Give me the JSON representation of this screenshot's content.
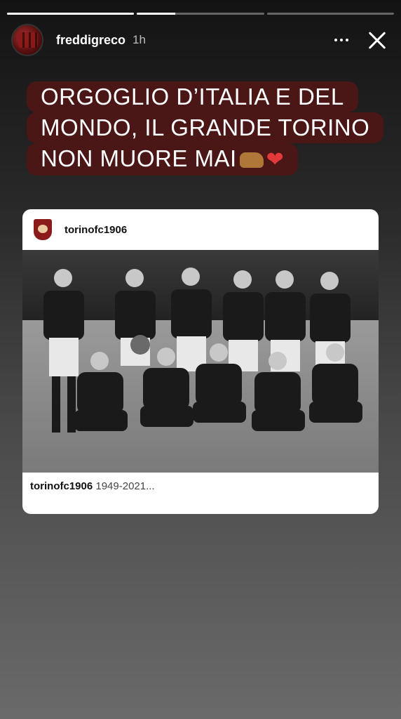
{
  "story": {
    "progress_segments": [
      1,
      0.3,
      0
    ],
    "username": "freddigreco",
    "time": "1h",
    "caption_lines": [
      "ORGOGLIO D’ITALIA E DEL",
      "MONDO, IL GRANDE TORINO",
      "NON MUORE MAI"
    ],
    "caption_emojis": [
      "ox-emoji",
      "heart-emoji"
    ],
    "caption_bg": "#4a1616"
  },
  "shared_post": {
    "author": "torinofc1906",
    "caption_author": "torinofc1906",
    "caption_text": "1949-2021..."
  }
}
